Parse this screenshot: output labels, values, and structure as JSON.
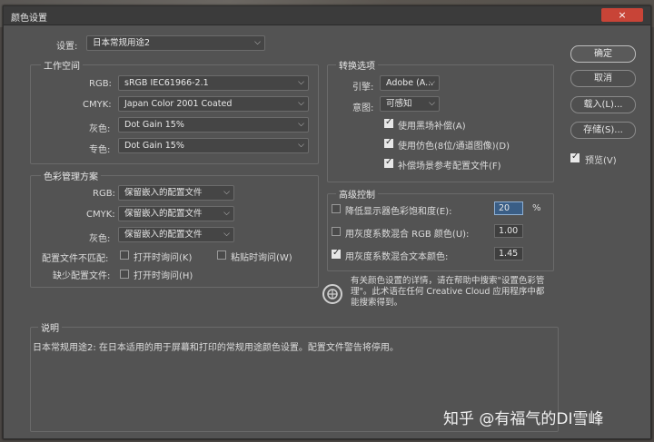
{
  "window": {
    "title": "颜色设置",
    "close_icon": "×"
  },
  "settings": {
    "label": "设置:",
    "value": "日本常规用途2"
  },
  "workspace": {
    "title": "工作空间",
    "rows": [
      {
        "label": "RGB:",
        "value": "sRGB IEC61966-2.1"
      },
      {
        "label": "CMYK:",
        "value": "Japan Color 2001 Coated"
      },
      {
        "label": "灰色:",
        "value": "Dot Gain 15%"
      },
      {
        "label": "专色:",
        "value": "Dot Gain 15%"
      }
    ]
  },
  "policies": {
    "title": "色彩管理方案",
    "rows": [
      {
        "label": "RGB:",
        "value": "保留嵌入的配置文件"
      },
      {
        "label": "CMYK:",
        "value": "保留嵌入的配置文件"
      },
      {
        "label": "灰色:",
        "value": "保留嵌入的配置文件"
      }
    ],
    "mismatch_label": "配置文件不匹配:",
    "ask_open": "打开时询问(K)",
    "ask_paste": "粘贴时询问(W)",
    "missing_label": "缺少配置文件:",
    "missing_ask_open": "打开时询问(H)"
  },
  "conversion": {
    "title": "转换选项",
    "engine_label": "引擎:",
    "engine_value": "Adobe (A...",
    "intent_label": "意图:",
    "intent_value": "可感知",
    "options": [
      "使用黑场补偿(A)",
      "使用仿色(8位/通道图像)(D)",
      "补偿场景参考配置文件(F)"
    ]
  },
  "advanced": {
    "title": "高级控制",
    "desaturate_label": "降低显示器色彩饱和度(E):",
    "desaturate_value": "20",
    "desaturate_unit": "%",
    "blend_rgb_label": "用灰度系数混合 RGB 颜色(U):",
    "blend_rgb_value": "1.00",
    "blend_text_label": "用灰度系数混合文本颜色:",
    "blend_text_value": "1.45"
  },
  "info_text": "有关颜色设置的详情，请在帮助中搜索\"设置色彩管理\"。此术语在任何 Creative Cloud 应用程序中都能搜索得到。",
  "description": {
    "title": "说明",
    "text": "日本常规用途2: 在日本适用的用于屏幕和打印的常规用途颜色设置。配置文件警告将停用。"
  },
  "buttons": {
    "ok": "确定",
    "cancel": "取消",
    "load": "载入(L)...",
    "save": "存储(S)...",
    "preview": "预览(V)"
  },
  "watermark": "知乎 @有福气的DI雪峰"
}
